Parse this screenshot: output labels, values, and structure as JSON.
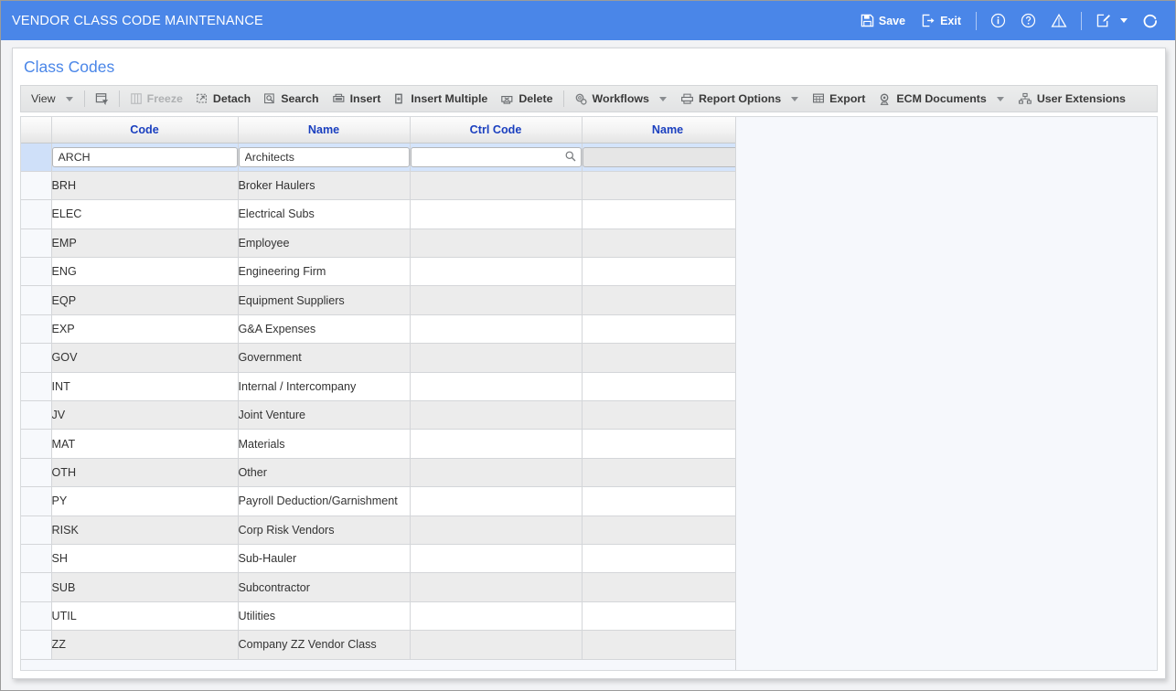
{
  "titlebar": {
    "title": "VENDOR CLASS CODE MAINTENANCE",
    "save_label": "Save",
    "exit_label": "Exit",
    "save_icon": "save-floppy-icon",
    "exit_icon": "exit-door-icon",
    "info_icon": "info-circle-icon",
    "help_icon": "help-question-icon",
    "warning_icon": "warning-triangle-icon",
    "notes_icon": "edit-note-icon",
    "notes_caret_icon": "chevron-down-icon",
    "refresh_icon": "refresh-circle-icon",
    "bg_color": "#4a86e8",
    "fg_color": "#ffffff"
  },
  "panel": {
    "title": "Class Codes",
    "title_color": "#4a86e8"
  },
  "toolbar": {
    "items": [
      {
        "label": "View",
        "icon": "view-menu-icon",
        "caret": true,
        "disabled": false,
        "bold": false
      },
      {
        "label": "",
        "icon": "query-filter-icon",
        "caret": false,
        "disabled": false,
        "bold": false
      },
      {
        "label": "Freeze",
        "icon": "freeze-columns-icon",
        "caret": false,
        "disabled": true,
        "bold": true
      },
      {
        "label": "Detach",
        "icon": "detach-window-icon",
        "caret": false,
        "disabled": false,
        "bold": true
      },
      {
        "label": "Search",
        "icon": "search-icon",
        "caret": false,
        "disabled": false,
        "bold": true
      },
      {
        "label": "Insert",
        "icon": "insert-row-icon",
        "caret": false,
        "disabled": false,
        "bold": true
      },
      {
        "label": "Insert Multiple",
        "icon": "insert-multiple-icon",
        "caret": false,
        "disabled": false,
        "bold": true
      },
      {
        "label": "Delete",
        "icon": "delete-row-icon",
        "caret": false,
        "disabled": false,
        "bold": true
      },
      {
        "label": "Workflows",
        "icon": "workflows-gears-icon",
        "caret": true,
        "disabled": false,
        "bold": true
      },
      {
        "label": "Report Options",
        "icon": "printer-icon",
        "caret": true,
        "disabled": false,
        "bold": true
      },
      {
        "label": "Export",
        "icon": "export-grid-icon",
        "caret": false,
        "disabled": false,
        "bold": true
      },
      {
        "label": "ECM Documents",
        "icon": "ecm-documents-icon",
        "caret": true,
        "disabled": false,
        "bold": true
      },
      {
        "label": "User Extensions",
        "icon": "user-extensions-icon",
        "caret": false,
        "disabled": false,
        "bold": true
      }
    ]
  },
  "grid": {
    "columns": [
      "Code",
      "Name",
      "Ctrl Code",
      "Name"
    ],
    "selected_row": {
      "code": "ARCH",
      "name": "Architects",
      "ctrl_code": "",
      "ctrl_name": "",
      "ctrl_code_icon": "magnifier-lov-icon",
      "ctrl_name_disabled": true
    },
    "rows": [
      {
        "code": "BRH",
        "name": "Broker Haulers",
        "ctrl_code": "",
        "ctrl_name": ""
      },
      {
        "code": "ELEC",
        "name": "Electrical Subs",
        "ctrl_code": "",
        "ctrl_name": ""
      },
      {
        "code": "EMP",
        "name": "Employee",
        "ctrl_code": "",
        "ctrl_name": ""
      },
      {
        "code": "ENG",
        "name": "Engineering Firm",
        "ctrl_code": "",
        "ctrl_name": ""
      },
      {
        "code": "EQP",
        "name": "Equipment Suppliers",
        "ctrl_code": "",
        "ctrl_name": ""
      },
      {
        "code": "EXP",
        "name": "G&A Expenses",
        "ctrl_code": "",
        "ctrl_name": ""
      },
      {
        "code": "GOV",
        "name": "Government",
        "ctrl_code": "",
        "ctrl_name": ""
      },
      {
        "code": "INT",
        "name": "Internal / Intercompany",
        "ctrl_code": "",
        "ctrl_name": ""
      },
      {
        "code": "JV",
        "name": "Joint Venture",
        "ctrl_code": "",
        "ctrl_name": ""
      },
      {
        "code": "MAT",
        "name": "Materials",
        "ctrl_code": "",
        "ctrl_name": ""
      },
      {
        "code": "OTH",
        "name": "Other",
        "ctrl_code": "",
        "ctrl_name": ""
      },
      {
        "code": "PY",
        "name": "Payroll Deduction/Garnishment",
        "ctrl_code": "",
        "ctrl_name": ""
      },
      {
        "code": "RISK",
        "name": "Corp Risk Vendors",
        "ctrl_code": "",
        "ctrl_name": ""
      },
      {
        "code": "SH",
        "name": "Sub-Hauler",
        "ctrl_code": "",
        "ctrl_name": ""
      },
      {
        "code": "SUB",
        "name": "Subcontractor",
        "ctrl_code": "",
        "ctrl_name": ""
      },
      {
        "code": "UTIL",
        "name": "Utilities",
        "ctrl_code": "",
        "ctrl_name": ""
      },
      {
        "code": "ZZ",
        "name": "Company ZZ Vendor Class",
        "ctrl_code": "",
        "ctrl_name": ""
      }
    ]
  }
}
